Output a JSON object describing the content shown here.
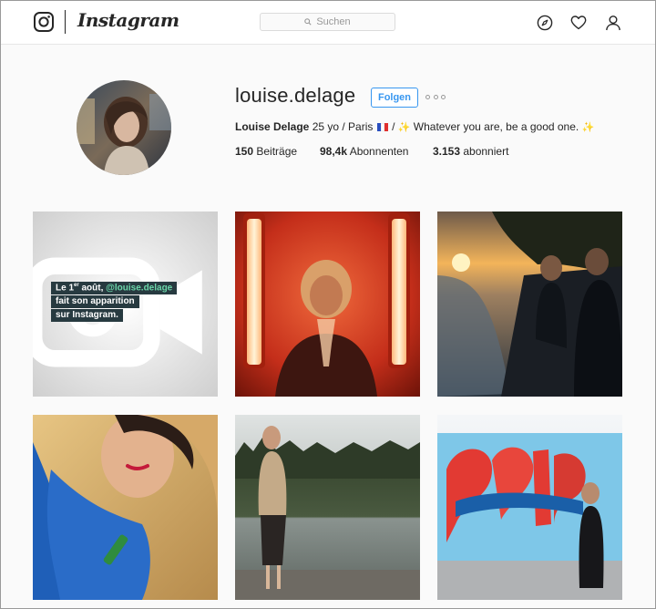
{
  "header": {
    "wordmark": "Instagram",
    "search_placeholder": "Suchen",
    "icons": [
      "instagram-glyph-icon",
      "compass-icon",
      "heart-icon",
      "person-icon"
    ]
  },
  "profile": {
    "username": "louise.delage",
    "follow_label": "Folgen",
    "full_name": "Louise Delage",
    "bio_part1": " 25 yo / Paris ",
    "bio_part2": " / ",
    "bio_part3": " Whatever you are, be a good one. ",
    "sparkle": "✨",
    "stats": {
      "posts_count": "150",
      "posts_label": " Beiträge",
      "followers_count": "98,4k",
      "followers_label": " Abonnenten",
      "following_count": "3.153",
      "following_label": " abonniert"
    }
  },
  "posts": {
    "first_post": {
      "line1_pre": "Le 1",
      "line1_sup": "er",
      "line1_mid": " août, ",
      "line1_mention": "@louise.delage",
      "line2": "fait son apparition",
      "line3": "sur Instagram."
    }
  },
  "colors": {
    "accent": "#3897f0",
    "text": "#262626",
    "background": "#fafafa",
    "mention": "#6bd6a9",
    "caption_bg": "#273a40"
  }
}
